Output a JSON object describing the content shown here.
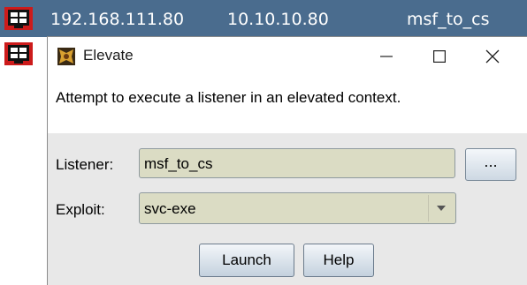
{
  "background_table": {
    "selected_row": {
      "host": "192.168.111.80",
      "internal": "10.10.10.80",
      "listener": "msf_to_cs"
    }
  },
  "dialog": {
    "title": "Elevate",
    "description": "Attempt to execute a listener in an elevated context.",
    "listener_label": "Listener:",
    "listener_value": "msf_to_cs",
    "browse_label": "...",
    "exploit_label": "Exploit:",
    "exploit_value": "svc-exe",
    "launch_label": "Launch",
    "help_label": "Help"
  },
  "colors": {
    "selected_row": "#4a6c8e",
    "field_background": "#dbdcc4",
    "dialog_background": "#e8e8e8"
  },
  "icons": {
    "session": "windows-session-icon",
    "title": "cobalt-strike-icon",
    "minimize": "minimize-icon",
    "maximize": "maximize-icon",
    "close": "close-icon",
    "dropdown": "chevron-down-icon"
  }
}
